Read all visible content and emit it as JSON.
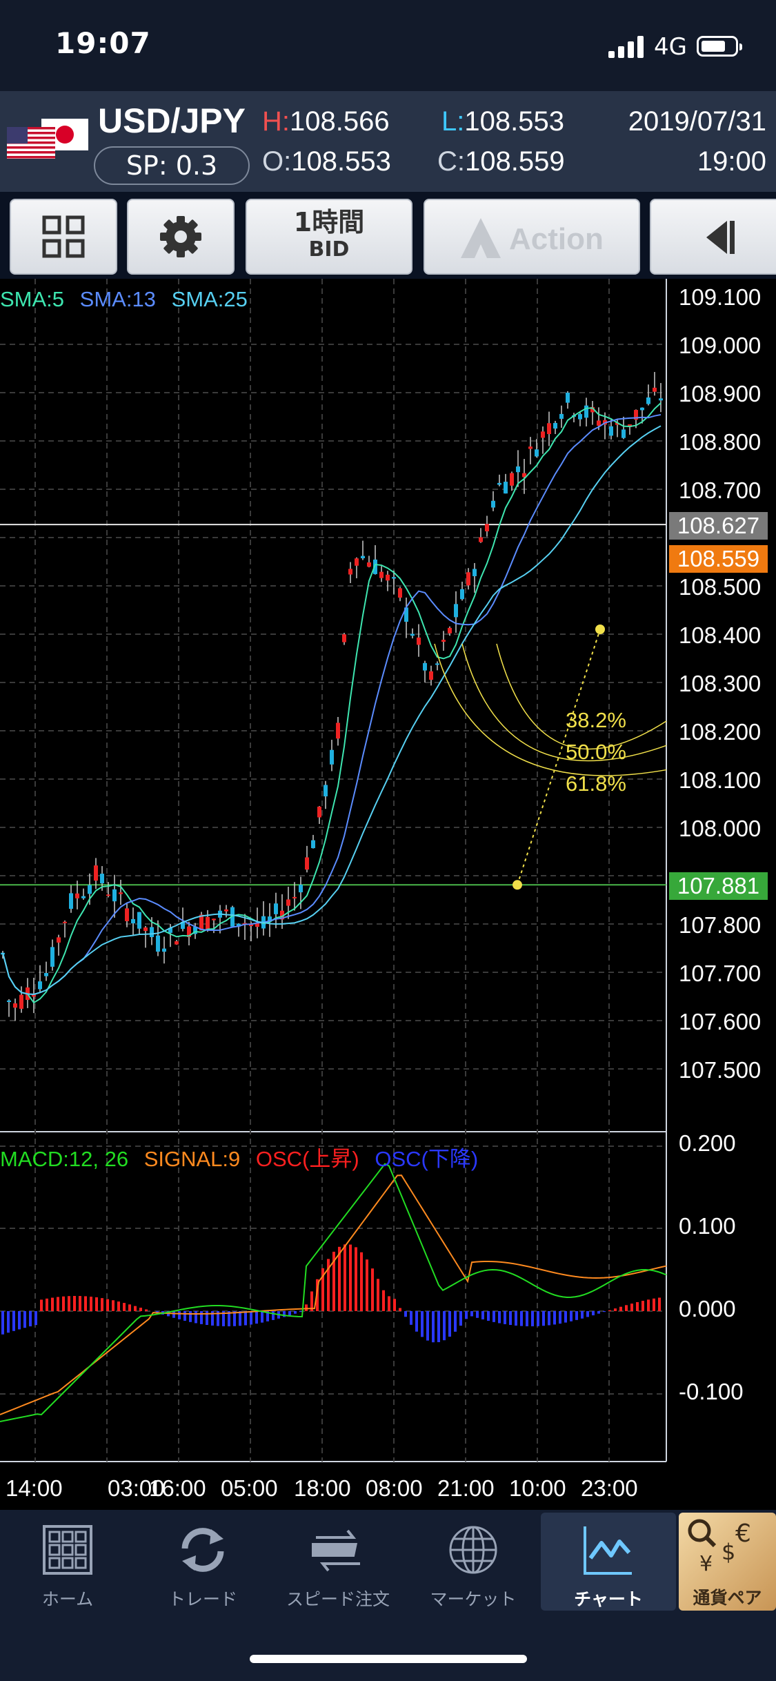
{
  "status": {
    "time": "19:07",
    "network": "4G"
  },
  "quote": {
    "pair": "USD/JPY",
    "spread": "SP: 0.3",
    "high_key": "H:",
    "high": "108.566",
    "low_key": "L:",
    "low": "108.553",
    "open_key": "O:",
    "open": "108.553",
    "close_key": "C:",
    "close": "108.559",
    "date": "2019/07/31",
    "time": "19:00"
  },
  "toolbar": {
    "menu_icon": "grid-icon",
    "settings_icon": "gear-icon",
    "timeframe": "1時間",
    "price_type": "BID",
    "action_label": "Action",
    "collapse_icon": "collapse-left-icon"
  },
  "chart": {
    "price_legend": [
      "SMA:5",
      "SMA:13",
      "SMA:25"
    ],
    "price_legend_colors": [
      "#3ee6b0",
      "#5b8cff",
      "#57d0f2"
    ],
    "macd_legend": [
      "MACD:12, 26",
      "SIGNAL:9",
      "OSC(上昇)",
      "OSC(下降)"
    ],
    "macd_legend_colors": [
      "#22dd22",
      "#ff8a1f",
      "#ff2020",
      "#2a38ff"
    ],
    "price_axis": [
      "109.100",
      "109.000",
      "108.900",
      "108.800",
      "108.700",
      "108.500",
      "108.400",
      "108.300",
      "108.200",
      "108.100",
      "108.000",
      "107.800",
      "107.700",
      "107.600",
      "107.500"
    ],
    "macd_axis": [
      "0.200",
      "0.100",
      "0.000",
      "-0.100"
    ],
    "time_axis": [
      "14:00",
      "03:00",
      "16:00",
      "05:00",
      "18:00",
      "08:00",
      "21:00",
      "10:00",
      "23:00"
    ],
    "tags": {
      "high_line": "108.627",
      "current": "108.559",
      "fib_base": "107.881"
    },
    "tag_colors": {
      "high_line": "#7a7a7a",
      "current": "#f07a10",
      "fib_base": "#37a83a"
    },
    "fibonacci": [
      "38.2%",
      "50.0%",
      "61.8%"
    ],
    "fib_color": "#f1e04a"
  },
  "tabs": [
    {
      "label": "ホーム",
      "icon": "home-grid-icon"
    },
    {
      "label": "トレード",
      "icon": "trade-refresh-icon"
    },
    {
      "label": "スピード注文",
      "icon": "speed-order-icon"
    },
    {
      "label": "マーケット",
      "icon": "globe-icon"
    },
    {
      "label": "チャート",
      "icon": "chart-icon",
      "selected": true
    },
    {
      "label": "通貨ペア",
      "icon": "currency-pair-icon"
    }
  ]
}
